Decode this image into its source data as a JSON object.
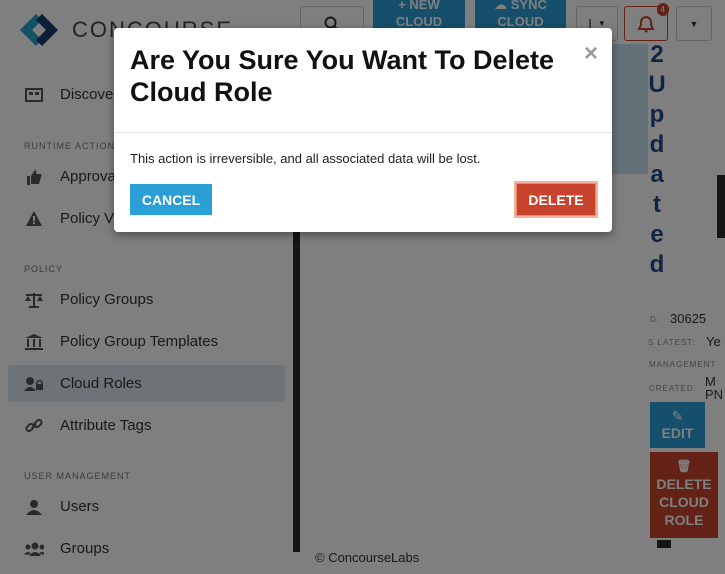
{
  "brand": {
    "name": "CONCOURSE"
  },
  "sidebar": {
    "discover": "Discover",
    "sections": {
      "runtime": "RUNTIME ACTIONS",
      "policy": "POLICY",
      "user_mgmt": "USER MANAGEMENT"
    },
    "runtime_items": [
      "Approvals",
      "Policy Violations"
    ],
    "policy_items": [
      "Policy Groups",
      "Policy Group Templates",
      "Cloud Roles",
      "Attribute Tags"
    ],
    "user_items": [
      "Users",
      "Groups"
    ]
  },
  "topbar": {
    "new_cloud": [
      "+ NEW",
      "CLOUD"
    ],
    "sync_cloud": [
      "SYNC",
      "CLOUD"
    ],
    "lang": "I",
    "notif_count": "4"
  },
  "page": {
    "vertical_title": [
      "2",
      "U",
      "p",
      "d",
      "a",
      "t",
      "e",
      "d"
    ],
    "meta": {
      "id_key": "D:",
      "id_val": "30625",
      "latest_key": "S LATEST:",
      "latest_val": "Ye",
      "mgmt_key": "MANAGEMENT",
      "created_key": "CREATED:",
      "created_val": [
        "M",
        "PN"
      ]
    },
    "edit": "EDIT",
    "delete_role": [
      "DELETE",
      "CLOUD",
      "ROLE"
    ],
    "footer": "© ConcourseLabs"
  },
  "modal": {
    "title": "Are You Sure You Want To Delete Cloud Role",
    "close": "×",
    "body": "This action is irreversible, and all associated data will be lost.",
    "cancel": "CANCEL",
    "delete": "DELETE"
  },
  "colors": {
    "primary": "#2a9fd6",
    "danger": "#c9432c",
    "active_nav": "#dbe7ef"
  }
}
